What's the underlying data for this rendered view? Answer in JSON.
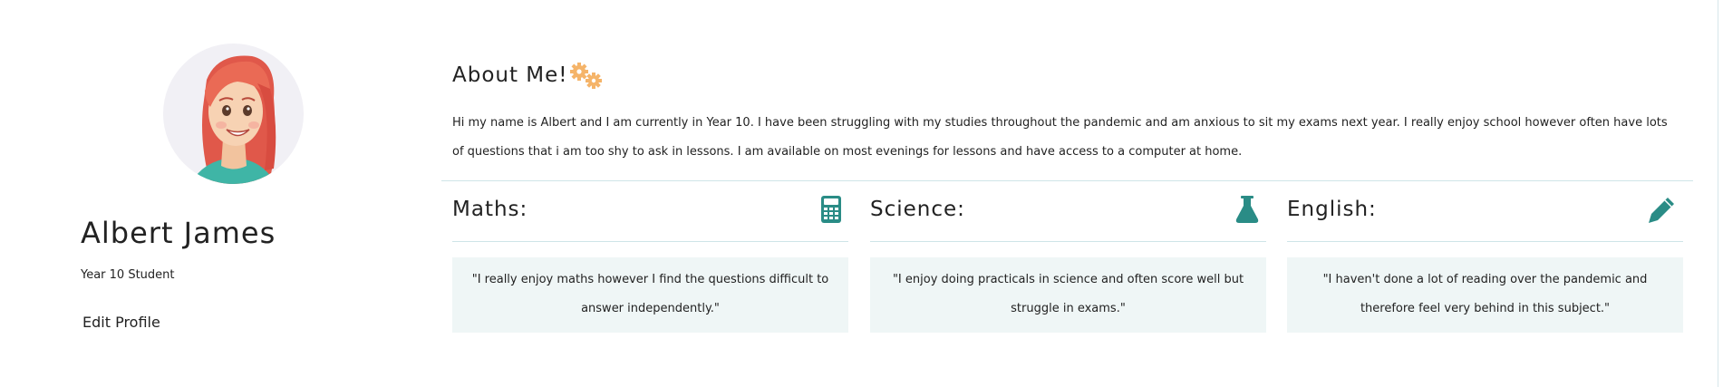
{
  "profile": {
    "name": "Albert James",
    "role": "Year 10 Student",
    "edit_label": "Edit Profile",
    "avatar_icon": "student-avatar"
  },
  "about": {
    "heading": "About Me!",
    "icon": "gears-icon",
    "text": "Hi my name is Albert and I am currently in Year 10. I have been struggling with my studies throughout the pandemic and am anxious to sit my exams next year. I really enjoy school however often have lots of questions that i am too shy to ask in lessons. I am available on most evenings for lessons and have access to a computer at home."
  },
  "subjects": [
    {
      "title": "Maths:",
      "icon": "calculator-icon",
      "quote": "\"I really enjoy maths however I find the questions difficult to answer independently.\""
    },
    {
      "title": "Science:",
      "icon": "flask-icon",
      "quote": "\"I enjoy doing practicals in science and often score well but struggle in exams.\""
    },
    {
      "title": "English:",
      "icon": "pencil-icon",
      "quote": "\"I haven't done a lot of reading over the pandemic and therefore feel very behind in this subject.\""
    }
  ],
  "colors": {
    "accent": "#2a8c86",
    "gear": "#f5b469",
    "quote_bg": "#eff6f6",
    "divider": "#cfe5e8",
    "avatar_bg": "#f1f0f5"
  }
}
